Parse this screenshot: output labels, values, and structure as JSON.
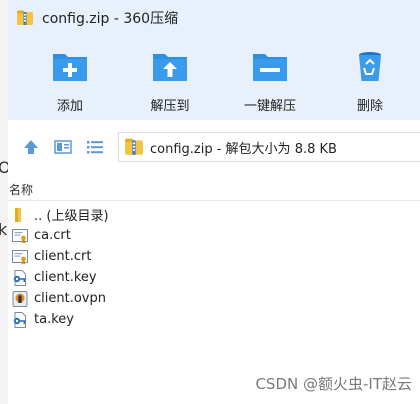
{
  "window": {
    "title": "config.zip - 360压缩"
  },
  "background_fragments": [
    "O",
    "k"
  ],
  "toolbar": {
    "add_label": "添加",
    "extract_to_label": "解压到",
    "one_click_extract_label": "一键解压",
    "delete_label": "删除"
  },
  "address": {
    "path": "config.zip - 解包大小为 8.8 KB"
  },
  "columns": {
    "name": "名称"
  },
  "files": [
    {
      "name": ".. (上级目录)",
      "icon": "folder-icon"
    },
    {
      "name": "ca.crt",
      "icon": "certificate-icon"
    },
    {
      "name": "client.crt",
      "icon": "certificate-icon"
    },
    {
      "name": "client.key",
      "icon": "key-file-icon"
    },
    {
      "name": "client.ovpn",
      "icon": "ovpn-lock-icon"
    },
    {
      "name": "ta.key",
      "icon": "key-file-icon"
    }
  ],
  "watermark": "CSDN @额火虫-IT赵云",
  "colors": {
    "toolbar_bg": "#e8f1fb",
    "icon_blue": "#2f8fe0",
    "folder_yellow": "#f5c342"
  }
}
